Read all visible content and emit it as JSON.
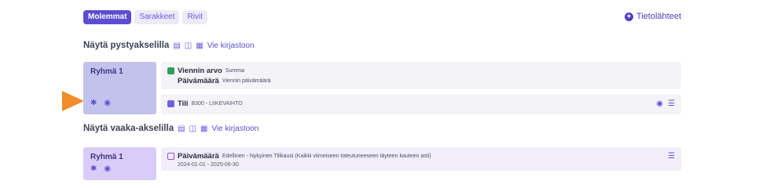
{
  "toolbar": {
    "segments": [
      "Molemmat",
      "Sarakkeet",
      "Rivit"
    ],
    "active_index": 0,
    "sources_label": "Tietolähteet"
  },
  "vertical": {
    "title": "Näytä pystyakselilla",
    "export_label": "Vie kirjastoon",
    "group_title": "Ryhmä 1",
    "measure_label": "Viennin arvo",
    "measure_sub": "Summa",
    "date_label": "Päivämäärä",
    "date_sub": "Viennin päivämäärä",
    "account_label": "Tili",
    "account_value": "B300 - LIIKEVAIHTO"
  },
  "horizontal": {
    "title": "Näytä vaaka-akselilla",
    "export_label": "Vie kirjastoon",
    "group_title": "Ryhmä 1",
    "date_label": "Päivämäärä",
    "date_desc": "Edellinen - Nykyinen Tilikausi (Kaikki viimeiseen toteutuneeseen täyteen kauteen asti)",
    "date_range": "2024-01-01 - 2025-06-30"
  },
  "colors": {
    "accent": "#5b4ed1",
    "group_vertical_bg": "#c3c2ec",
    "group_horizontal_bg": "#d9cdf7",
    "pointer_arrow": "#f28c28"
  }
}
